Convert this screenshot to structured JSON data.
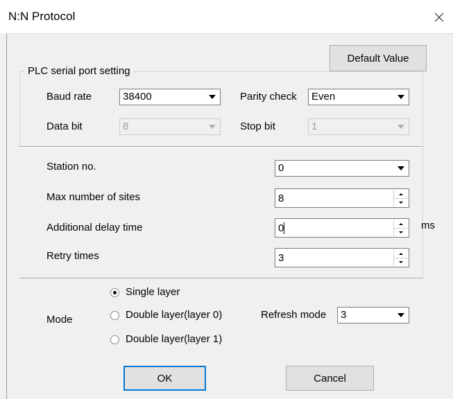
{
  "window": {
    "title": "N:N Protocol"
  },
  "default_value_label": "Default Value",
  "plc_group": {
    "title": "PLC serial port setting",
    "baud_rate_label": "Baud rate",
    "baud_rate_value": "38400",
    "parity_label": "Parity check",
    "parity_value": "Even",
    "data_bit_label": "Data bit",
    "data_bit_value": "8",
    "stop_bit_label": "Stop bit",
    "stop_bit_value": "1"
  },
  "station": {
    "station_no_label": "Station no.",
    "station_no_value": "0",
    "max_sites_label": "Max number of sites",
    "max_sites_value": "8",
    "delay_label": "Additional delay time",
    "delay_value": "0",
    "delay_unit": "ms",
    "retry_label": "Retry times",
    "retry_value": "3"
  },
  "mode": {
    "label": "Mode",
    "options": [
      "Single layer",
      "Double layer(layer 0)",
      "Double layer(layer 1)"
    ],
    "selected_index": 0,
    "refresh_label": "Refresh mode",
    "refresh_value": "3"
  },
  "footer": {
    "ok_label": "OK",
    "cancel_label": "Cancel"
  }
}
